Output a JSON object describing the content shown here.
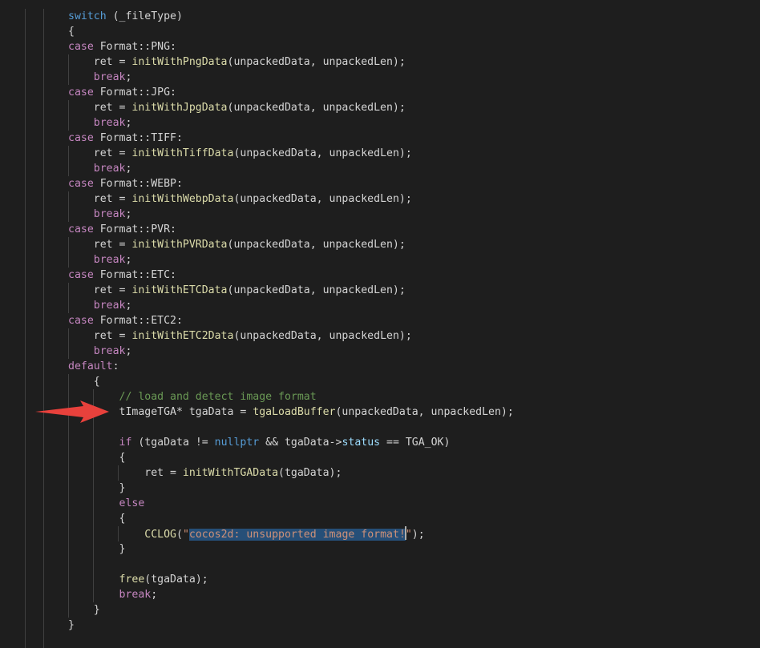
{
  "code": {
    "lines": [
      "switch (_fileType)",
      "{",
      "case Format::PNG:",
      "    ret = initWithPngData(unpackedData, unpackedLen);",
      "    break;",
      "case Format::JPG:",
      "    ret = initWithJpgData(unpackedData, unpackedLen);",
      "    break;",
      "case Format::TIFF:",
      "    ret = initWithTiffData(unpackedData, unpackedLen);",
      "    break;",
      "case Format::WEBP:",
      "    ret = initWithWebpData(unpackedData, unpackedLen);",
      "    break;",
      "case Format::PVR:",
      "    ret = initWithPVRData(unpackedData, unpackedLen);",
      "    break;",
      "case Format::ETC:",
      "    ret = initWithETCData(unpackedData, unpackedLen);",
      "    break;",
      "case Format::ETC2:",
      "    ret = initWithETC2Data(unpackedData, unpackedLen);",
      "    break;",
      "default:",
      "    {",
      "        // load and detect image format",
      "        tImageTGA* tgaData = tgaLoadBuffer(unpackedData, unpackedLen);",
      "",
      "        if (tgaData != nullptr && tgaData->status == TGA_OK)",
      "        {",
      "            ret = initWithTGAData(tgaData);",
      "        }",
      "        else",
      "        {",
      "            CCLOG(\"cocos2d: unsupported image format!\");",
      "        }",
      "",
      "        free(tgaData);",
      "        break;",
      "    }",
      "}"
    ],
    "selected_text": "cocos2d: unsupported image format!",
    "highlighted_line": 27
  },
  "colors": {
    "background": "#1e1e1e",
    "default_text": "#d4d4d4",
    "keyword": "#569cd6",
    "control_keyword": "#c586c0",
    "function": "#dcdcaa",
    "comment": "#6a9955",
    "string": "#ce9178",
    "member": "#9cdcfe",
    "selection": "#264f78",
    "annotation_arrow": "#e8413c"
  },
  "icons": {
    "annotation": "red-arrow-icon"
  }
}
